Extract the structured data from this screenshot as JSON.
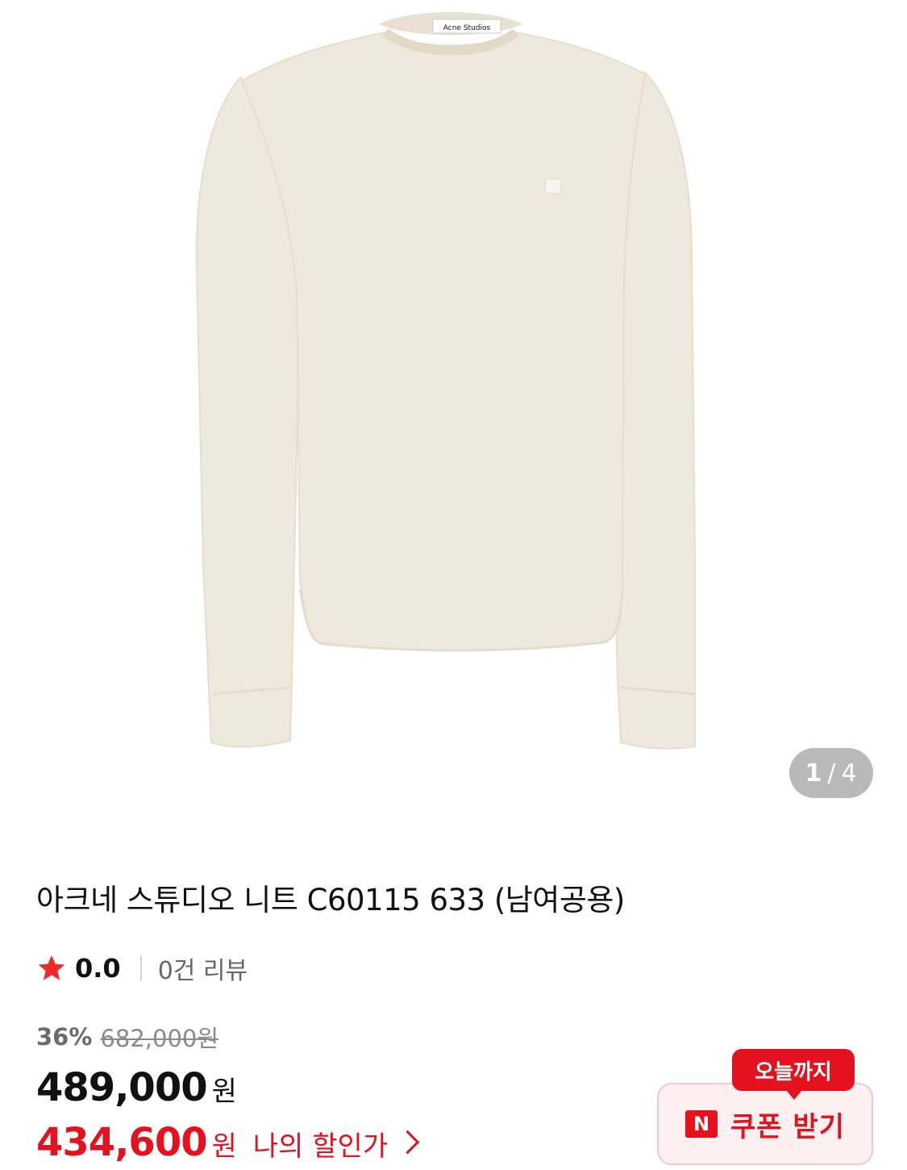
{
  "gallery": {
    "brand_label": "Acne Studios",
    "current_page": "1",
    "separator": "/",
    "total_pages": "4",
    "sweater_color": "#efe8dc"
  },
  "product": {
    "title": "아크네 스튜디오 니트 C60115 633 (남여공용)"
  },
  "rating": {
    "icon": "star-icon",
    "value": "0.0",
    "review_count": "0건 리뷰"
  },
  "price": {
    "discount_rate": "36%",
    "original_price": "682,000원",
    "sale_price": "489,000",
    "sale_unit": "원",
    "my_price": "434,600",
    "my_unit": "원",
    "my_price_label": "나의 할인가"
  },
  "coupon": {
    "badge": "오늘까지",
    "n_icon": "N",
    "label": "쿠폰 받기"
  },
  "colors": {
    "accent": "#e4111e",
    "coupon_bg": "#fdf0f1"
  }
}
